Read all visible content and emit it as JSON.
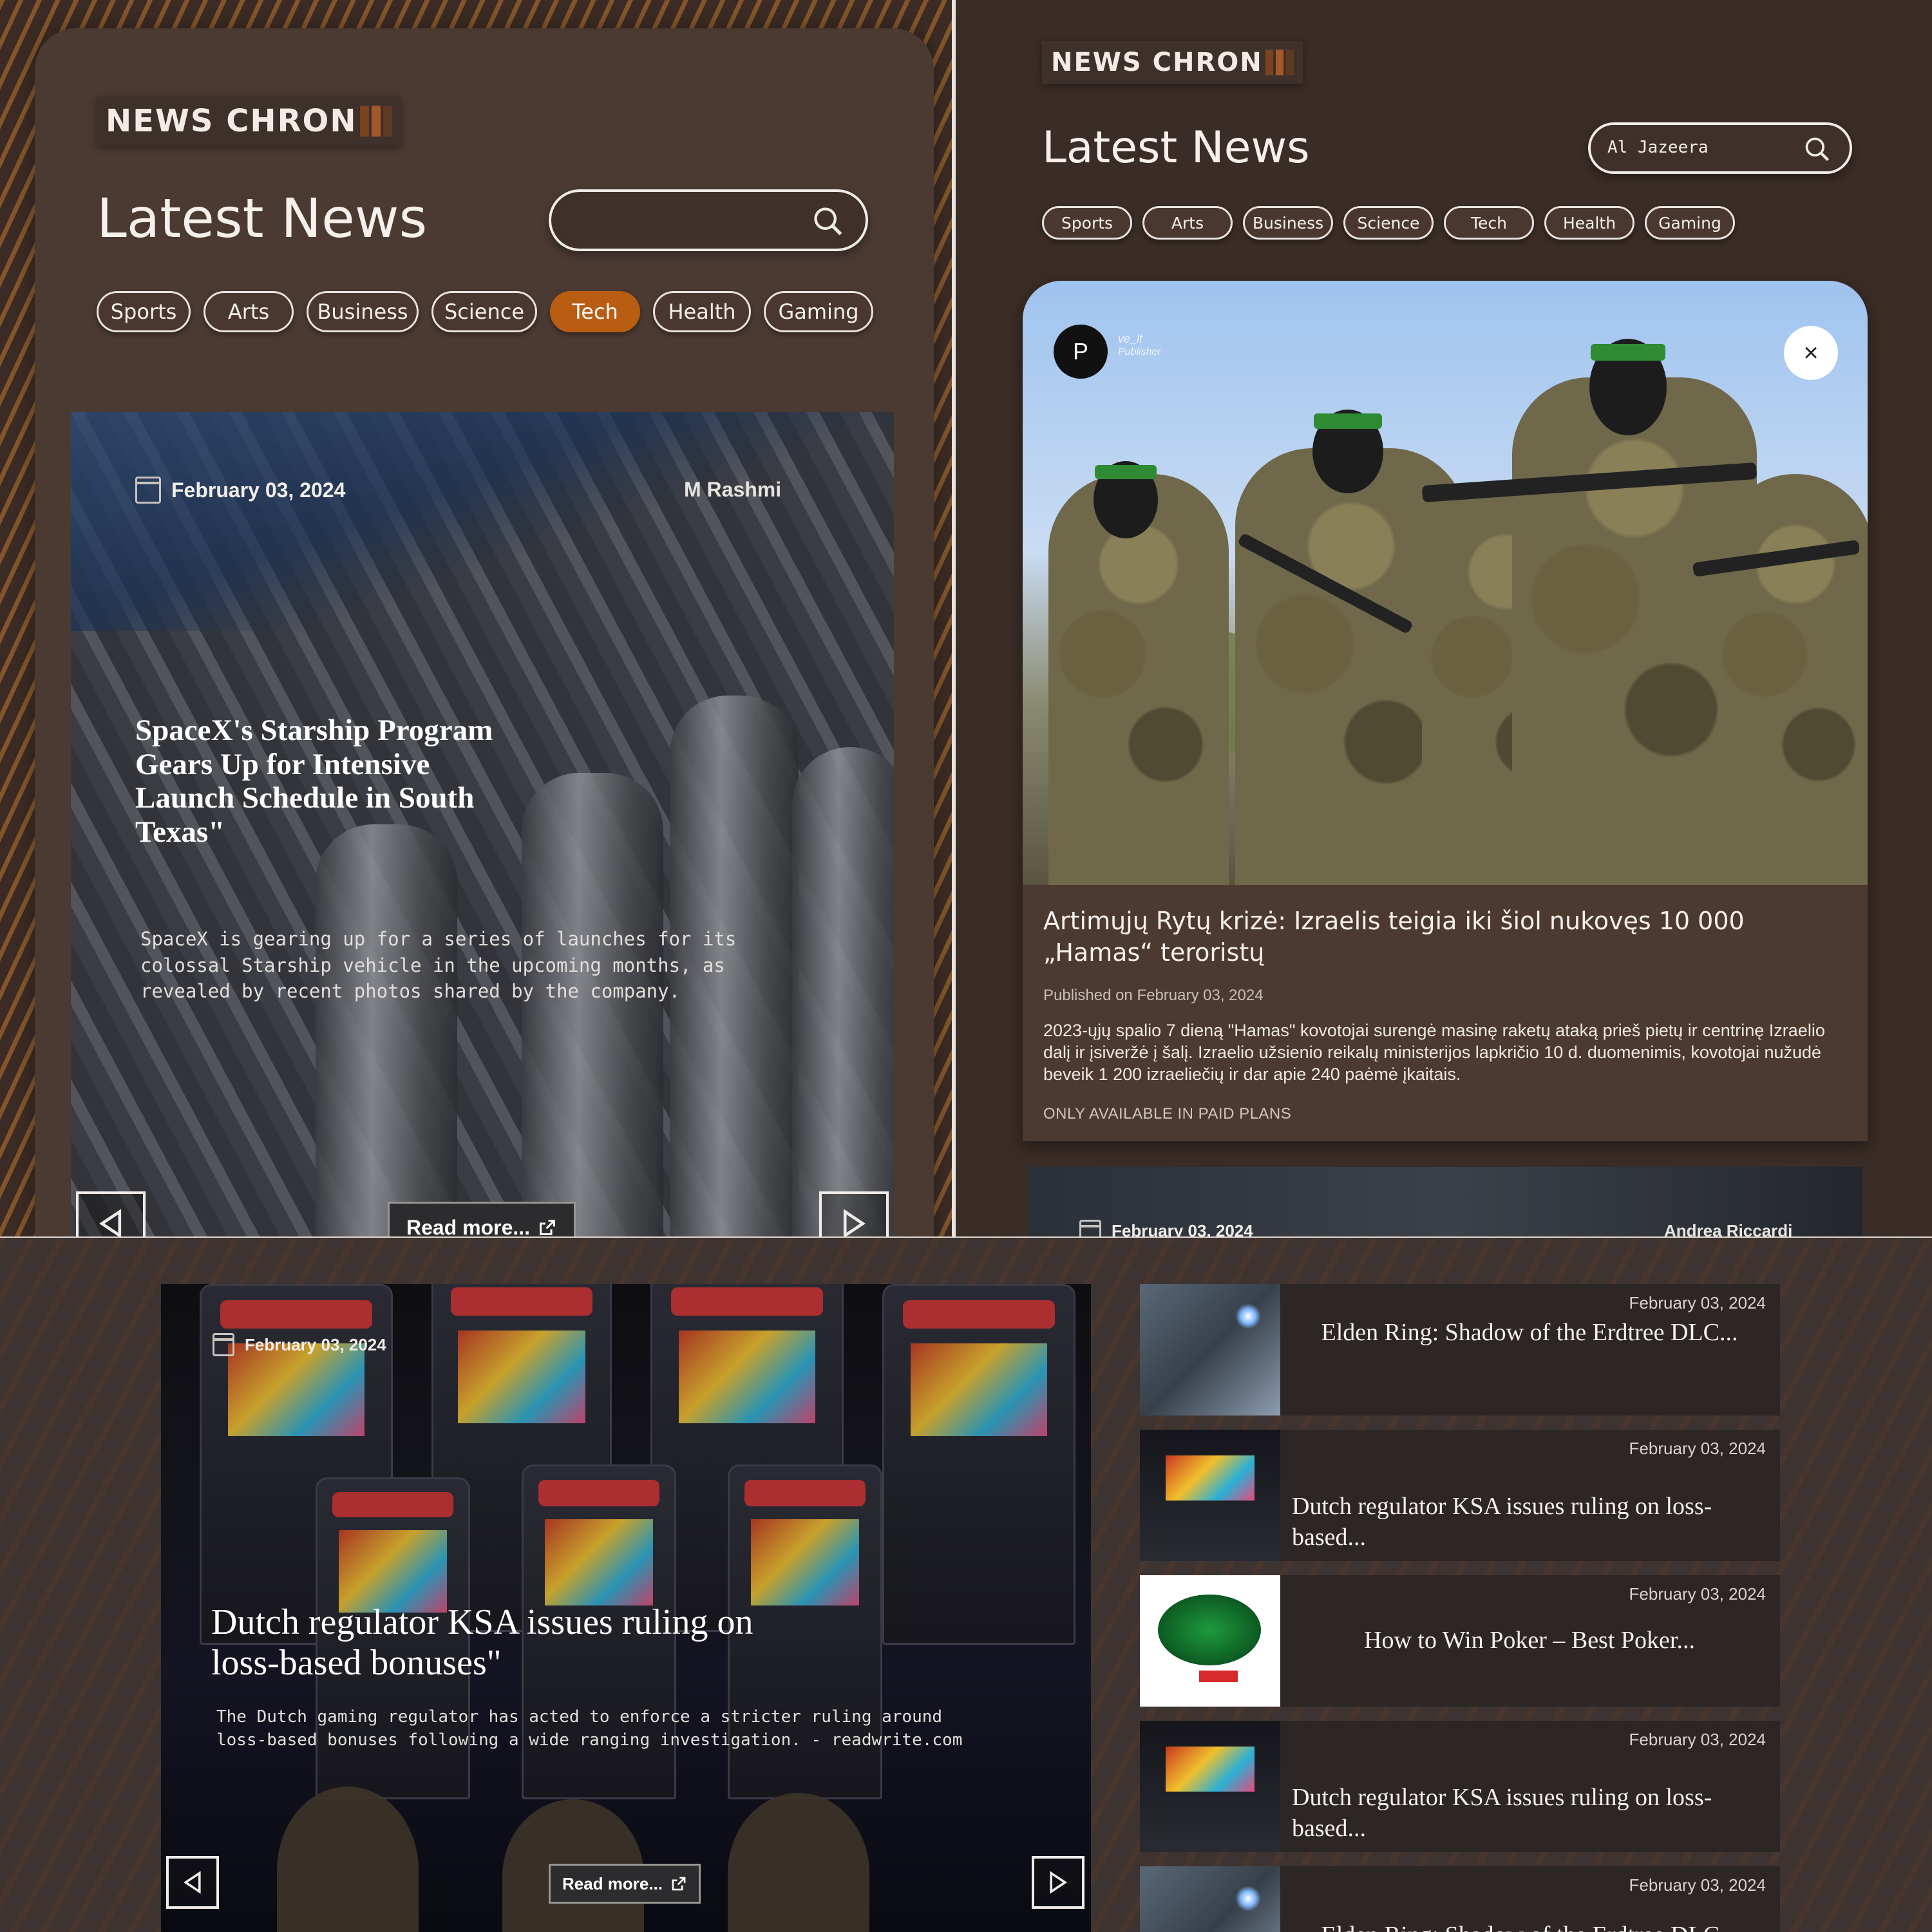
{
  "brand": {
    "logo_text": "NEWS CHRON"
  },
  "panel_a": {
    "heading": "Latest News",
    "search": {
      "value": ""
    },
    "categories": [
      "Sports",
      "Arts",
      "Business",
      "Science",
      "Tech",
      "Health",
      "Gaming"
    ],
    "active_category": "Tech",
    "article": {
      "date": "February 03, 2024",
      "author": "M Rashmi",
      "title": "SpaceX's Starship Program Gears Up for Intensive Launch Schedule in South Texas\"",
      "summary": "SpaceX is gearing up for a series of launches for its colossal Starship vehicle in the upcoming months, as revealed by recent photos shared by the company.",
      "read_more": "Read more..."
    }
  },
  "panel_b": {
    "heading": "Latest News",
    "search": {
      "value": "Al Jazeera"
    },
    "categories": [
      "Sports",
      "Arts",
      "Business",
      "Science",
      "Tech",
      "Health",
      "Gaming"
    ],
    "modal": {
      "publisher_initial": "P",
      "publisher_name": "ve_lt",
      "publisher_role": "Publisher",
      "close": "×",
      "title": "Artimųjų Rytų krizė: Izraelis teigia iki šiol nukovęs 10 000 „Hamas“ teroristų",
      "published": "Published on February 03, 2024",
      "body": "2023-ųjų spalio 7 dieną \"Hamas\" kovotojai surengė masinę raketų ataką prieš pietų ir centrinę Izraelio dalį ir įsiveržė į šalį. Izraelio užsienio reikalų ministerijos lapkričio 10 d. duomenimis, kovotojai nužudė beveik 1 200 izraeliečių ir dar apie 240 paėmė įkaitais.",
      "paid_note": "ONLY AVAILABLE IN PAID PLANS"
    },
    "next_article": {
      "date": "February 03, 2024",
      "author": "Andrea Riccardi"
    }
  },
  "panel_c": {
    "hero": {
      "date": "February 03, 2024",
      "title": "Dutch regulator KSA issues ruling on loss-based bonuses\"",
      "summary": "The Dutch gaming regulator has acted to enforce a stricter ruling around loss-based bonuses following a wide ranging investigation. - readwrite.com",
      "read_more": "Read more..."
    },
    "list": [
      {
        "date": "February 03, 2024",
        "title": "Elden Ring: Shadow of the Erdtree DLC...",
        "thumb": "elden"
      },
      {
        "date": "February 03, 2024",
        "title": "Dutch regulator KSA issues ruling on loss-based...",
        "thumb": "slots"
      },
      {
        "date": "February 03, 2024",
        "title": "How to Win Poker – Best Poker...",
        "thumb": "poker"
      },
      {
        "date": "February 03, 2024",
        "title": "Dutch regulator KSA issues ruling on loss-based...",
        "thumb": "slots"
      },
      {
        "date": "February 03, 2024",
        "title": "Elden Ring: Shadow of the Erdtree DLC...",
        "thumb": "elden"
      }
    ]
  },
  "colors": {
    "accent": "#b85d12",
    "background": "#3b2b24",
    "card": "#4a3a32"
  },
  "icons": {
    "search": "search-icon",
    "calendar": "calendar-icon",
    "prev": "prev-arrow-icon",
    "next": "next-arrow-icon",
    "external": "external-link-icon",
    "close": "close-icon"
  }
}
